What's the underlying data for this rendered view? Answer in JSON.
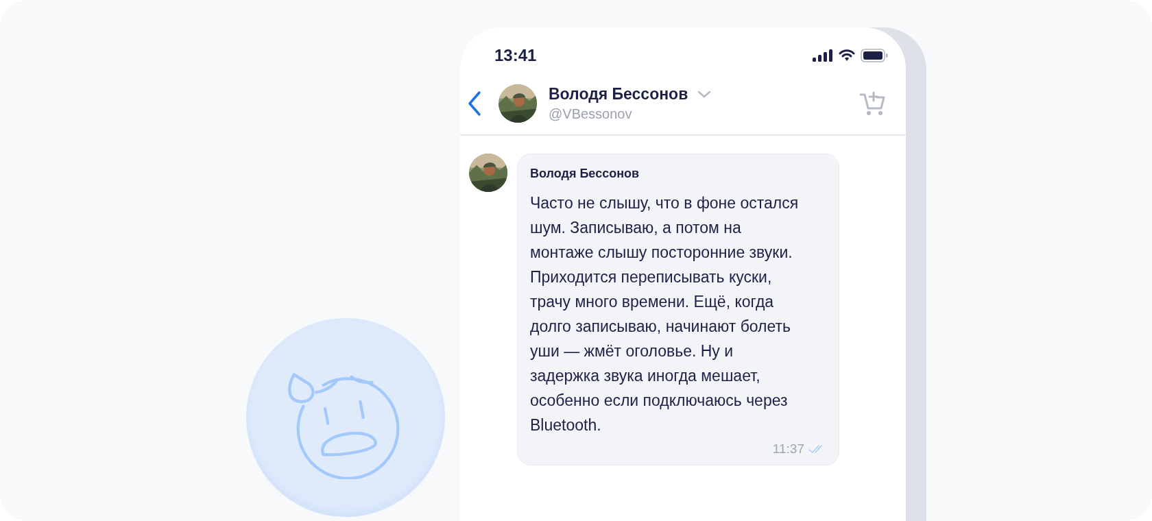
{
  "status_bar": {
    "time": "13:41"
  },
  "header": {
    "name": "Володя Бессонов",
    "handle": "@VBessonov"
  },
  "messages": [
    {
      "sender": "Володя Бессонов",
      "text": "Часто не слышу, что в фоне остался шум. Записываю, а потом на монтаже слышу посторонние звуки. Приходится переписывать куски, трачу много времени. Ещё, когда долго записываю, начинают болеть уши — жмёт оголовье. Ну и задержка звука иногда мешает, особенно если подключаюсь через Bluetooth.",
      "time": "11:37",
      "read": true
    }
  ]
}
